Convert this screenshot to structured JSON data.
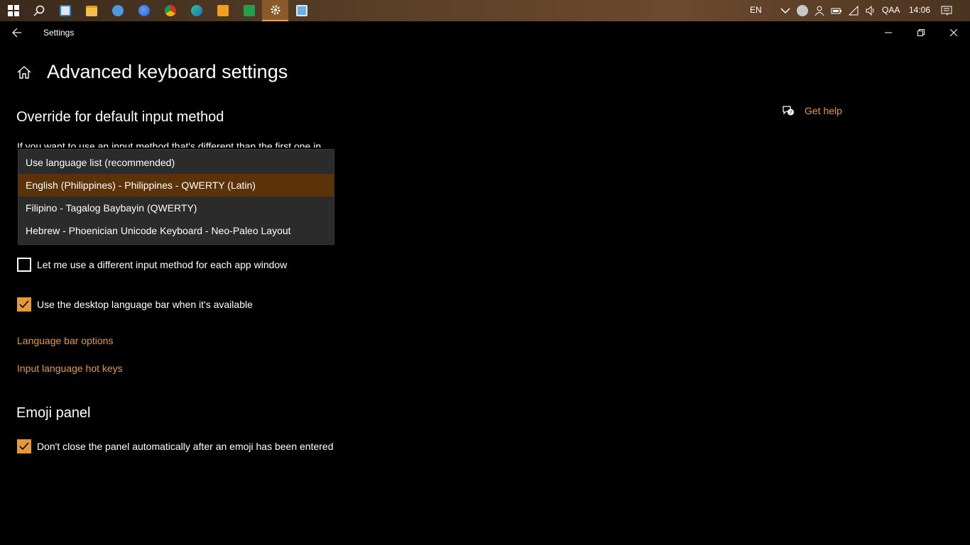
{
  "taskbar": {
    "language": "EN",
    "ime": "QAA",
    "time": "14:06"
  },
  "window": {
    "app_title": "Settings"
  },
  "page": {
    "title": "Advanced keyboard settings",
    "get_help": "Get help"
  },
  "override": {
    "title": "Override for default input method",
    "description": "If you want to use an input method that's different than the first one in",
    "dropdown_options": [
      {
        "label": "Use language list (recommended)",
        "selected": false
      },
      {
        "label": "English (Philippines) - Philippines - QWERTY (Latin)",
        "selected": true
      },
      {
        "label": "Filipino - Tagalog Baybayin (QWERTY)",
        "selected": false
      },
      {
        "label": "Hebrew - Phoenician Unicode Keyboard - Neo-Paleo Layout",
        "selected": false
      }
    ]
  },
  "switching": {
    "per_app_label": "Let me use a different input method for each app window",
    "per_app_checked": false,
    "desktop_bar_label": "Use the desktop language bar when it's available",
    "desktop_bar_checked": true,
    "language_bar_options": "Language bar options",
    "hot_keys": "Input language hot keys"
  },
  "emoji": {
    "title": "Emoji panel",
    "dont_close_label": "Don't close the panel automatically after an emoji has been entered",
    "dont_close_checked": true
  },
  "colors": {
    "accent": "#e39a3b",
    "selected_item": "#5c3208",
    "background": "#000000"
  }
}
